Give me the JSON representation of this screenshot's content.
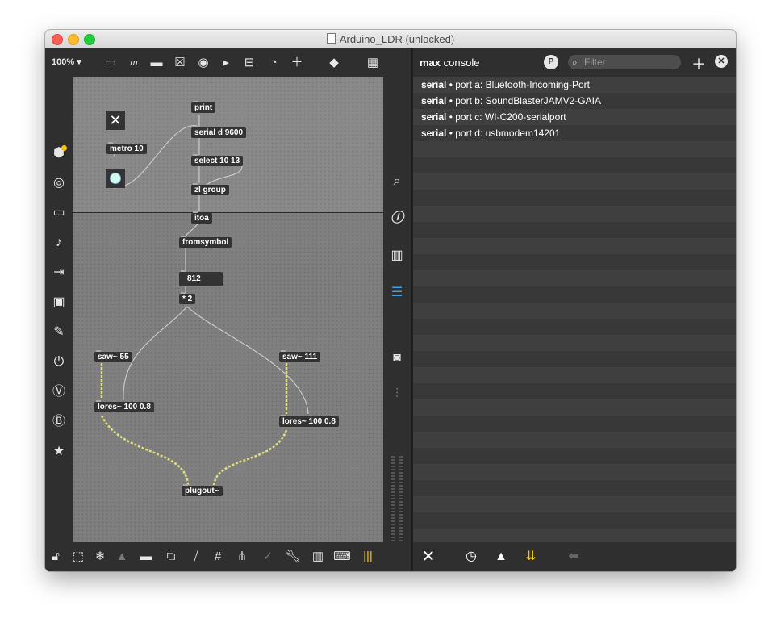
{
  "window": {
    "title": "Arduino_LDR (unlocked)"
  },
  "toolbar": {
    "zoom": "100%"
  },
  "patch": {
    "objects": [
      {
        "id": "print",
        "label": "print"
      },
      {
        "id": "serial",
        "label": "serial d 9600"
      },
      {
        "id": "metro",
        "label": "metro 10"
      },
      {
        "id": "select",
        "label": "select 10 13"
      },
      {
        "id": "zlgroup",
        "label": "zl group"
      },
      {
        "id": "itoa",
        "label": "itoa"
      },
      {
        "id": "fromsymbol",
        "label": "fromsymbol"
      },
      {
        "id": "number",
        "label": "812"
      },
      {
        "id": "mult",
        "label": "* 2"
      },
      {
        "id": "saw1",
        "label": "saw~ 55"
      },
      {
        "id": "saw2",
        "label": "saw~ 111"
      },
      {
        "id": "lores1",
        "label": "lores~ 100 0.8"
      },
      {
        "id": "lores2",
        "label": "lores~ 100 0.8"
      },
      {
        "id": "plugout",
        "label": "plugout~"
      }
    ]
  },
  "console": {
    "title_bold": "max",
    "title_rest": " console",
    "filter_placeholder": "Filter",
    "rows": [
      {
        "source": "serial",
        "message": " • port a: Bluetooth-Incoming-Port"
      },
      {
        "source": "serial",
        "message": " • port b: SoundBlasterJAMV2-GAIA"
      },
      {
        "source": "serial",
        "message": " • port c: WI-C200-serialport"
      },
      {
        "source": "serial",
        "message": " • port d: usbmodem14201"
      }
    ]
  },
  "colors": {
    "accent": "#f5c400",
    "highlight_blue": "#3ea0e8",
    "window_bg": "#333333",
    "canvas_bg": "#7f7f7f"
  }
}
